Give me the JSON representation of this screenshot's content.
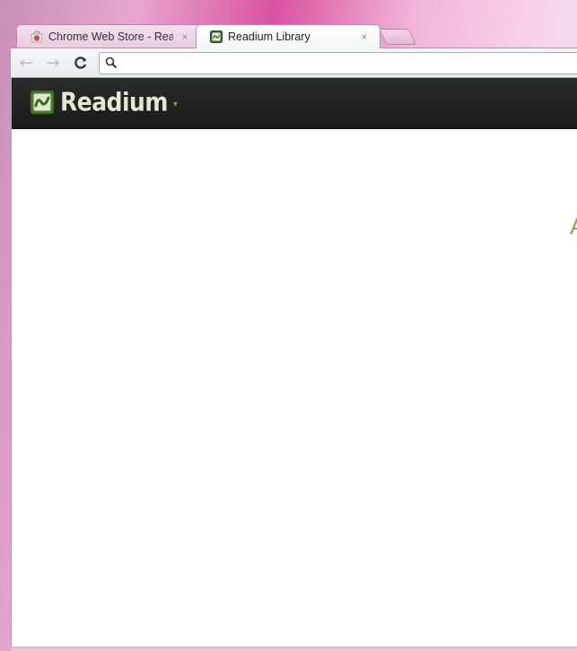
{
  "tabs": [
    {
      "title": "Chrome Web Store - Readium",
      "favicon": "chrome-web-store-icon",
      "active": false
    },
    {
      "title": "Readium Library",
      "favicon": "readium-favicon-icon",
      "active": true
    }
  ],
  "close_glyph": "×",
  "toolbar": {
    "back_glyph": "←",
    "forward_glyph": "→",
    "reload_glyph": "C",
    "omnibox": {
      "value": "",
      "placeholder": ""
    }
  },
  "app": {
    "brand_name": "Readium",
    "brand_caret": "▾",
    "partial_glyph": "A"
  },
  "colors": {
    "app_bar": "#1f1f1f",
    "brand_text": "#e4e8d3",
    "accent_green": "#7bb338"
  }
}
